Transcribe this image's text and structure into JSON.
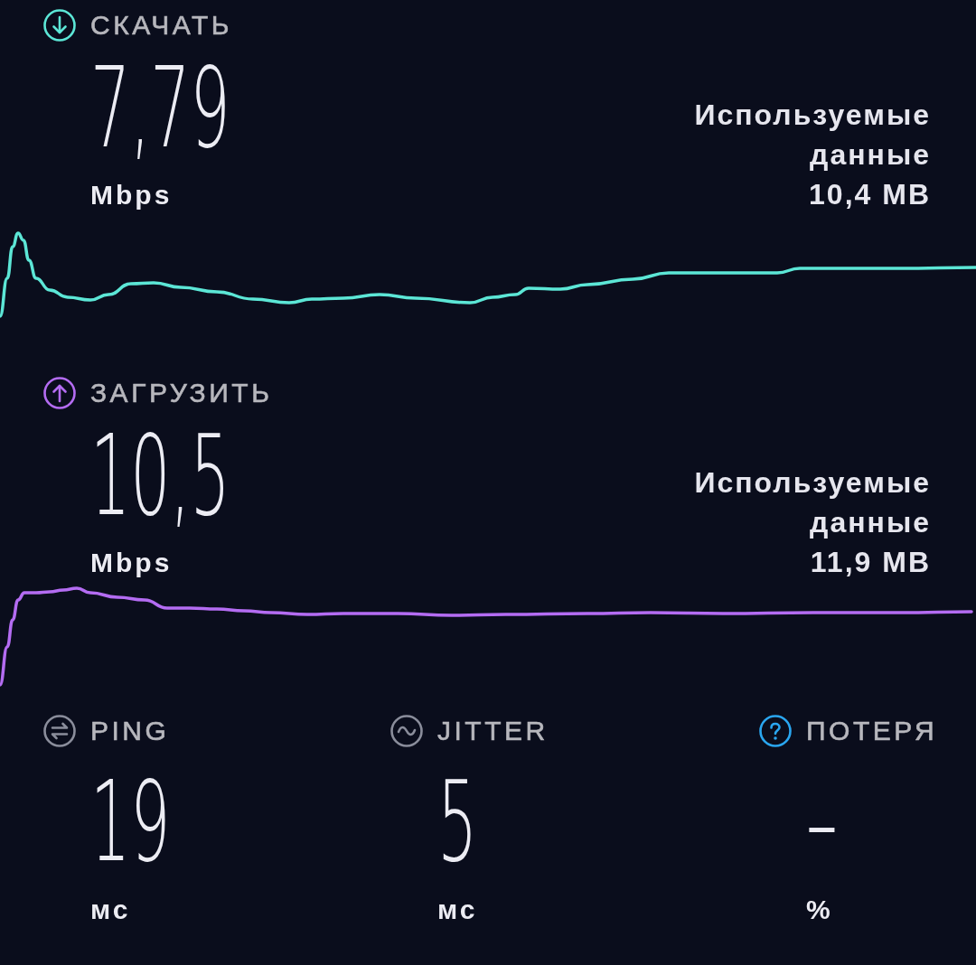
{
  "tests": [
    {
      "kind": "download",
      "color": "#5ce6d6",
      "label": "СКАЧАТЬ",
      "value": "7,79",
      "unit": "Mbps",
      "data_used_label": "Используемые данные",
      "data_used": "10,4 MB"
    },
    {
      "kind": "upload",
      "color": "#b46cf2",
      "label": "ЗАГРУЗИТЬ",
      "value": "10,5",
      "unit": "Mbps",
      "data_used_label": "Используемые данные",
      "data_used": "11,9 MB"
    }
  ],
  "stats": [
    {
      "kind": "ping",
      "color": "#8a8d9b",
      "label": "PING",
      "value": "19",
      "unit": "мс"
    },
    {
      "kind": "jitter",
      "color": "#8a8d9b",
      "label": "JITTER",
      "value": "5",
      "unit": "мс"
    },
    {
      "kind": "packet_loss",
      "color": "#2aa6f0",
      "label": "ПОТЕРЯ",
      "value": "–",
      "unit": "%"
    }
  ]
}
